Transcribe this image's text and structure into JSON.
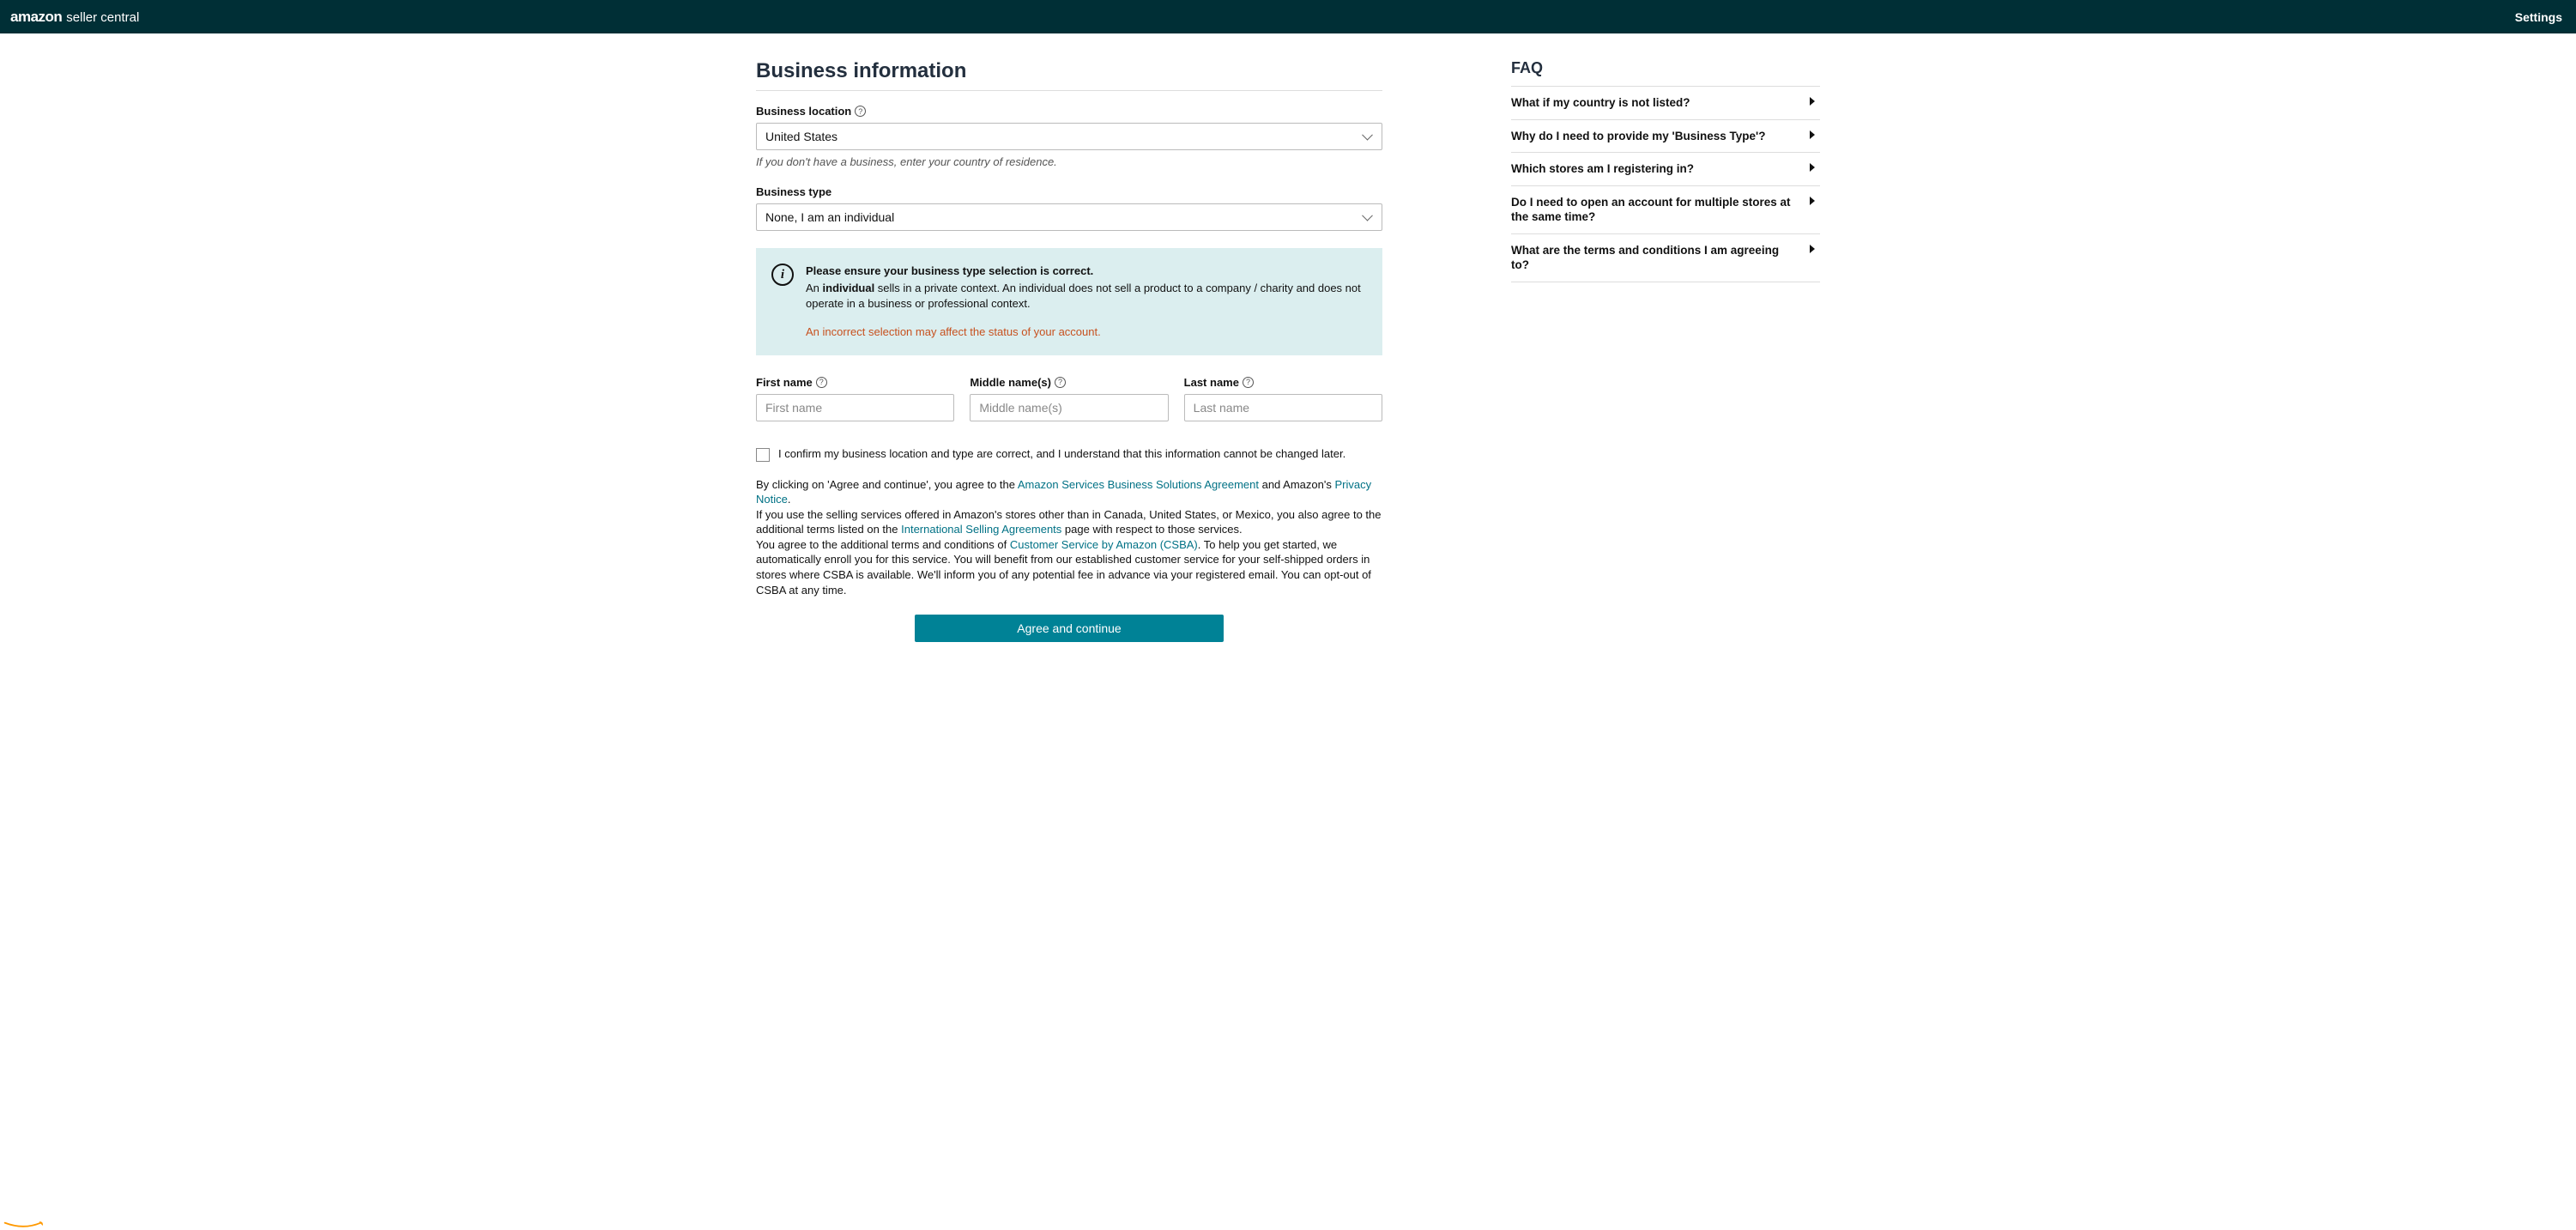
{
  "header": {
    "logo_amazon": "amazon",
    "logo_rest": "seller central",
    "settings": "Settings"
  },
  "main": {
    "title": "Business information",
    "business_location": {
      "label": "Business location",
      "value": "United States",
      "helper": "If you don't have a business, enter your country of residence."
    },
    "business_type": {
      "label": "Business type",
      "value": "None, I am an individual"
    },
    "info": {
      "title": "Please ensure your business type selection is correct.",
      "line_prefix": "An ",
      "line_bold": "individual",
      "line_rest": " sells in a private context. An individual does not sell a product to a company / charity and does not operate in a business or professional context.",
      "warn": "An incorrect selection may affect the status of your account."
    },
    "names": {
      "first_label": "First name",
      "first_placeholder": "First name",
      "middle_label": "Middle name(s)",
      "middle_placeholder": "Middle name(s)",
      "last_label": "Last name",
      "last_placeholder": "Last name"
    },
    "confirm": "I confirm my business location and type are correct, and I understand that this information cannot be changed later.",
    "legal": {
      "p1a": "By clicking on 'Agree and continue', you agree to the ",
      "link1": "Amazon Services Business Solutions Agreement",
      "p1b": " and Amazon's ",
      "link2": "Privacy Notice",
      "p1c": ".",
      "p2a": "If you use the selling services offered in Amazon's stores other than in Canada, United States, or Mexico, you also agree to the additional terms listed on the ",
      "link3": "International Selling Agreements",
      "p2b": " page with respect to those services.",
      "p3a": "You agree to the additional terms and conditions of ",
      "link4": "Customer Service by Amazon (CSBA)",
      "p3b": ". To help you get started, we automatically enroll you for this service. You will benefit from our established customer service for your self-shipped orders in stores where CSBA is available. We'll inform you of any potential fee in advance via your registered email. You can opt-out of CSBA at any time."
    },
    "cta": "Agree and continue"
  },
  "faq": {
    "title": "FAQ",
    "items": [
      "What if my country is not listed?",
      "Why do I need to provide my 'Business Type'?",
      "Which stores am I registering in?",
      "Do I need to open an account for multiple stores at the same time?",
      "What are the terms and conditions I am agreeing to?"
    ]
  }
}
